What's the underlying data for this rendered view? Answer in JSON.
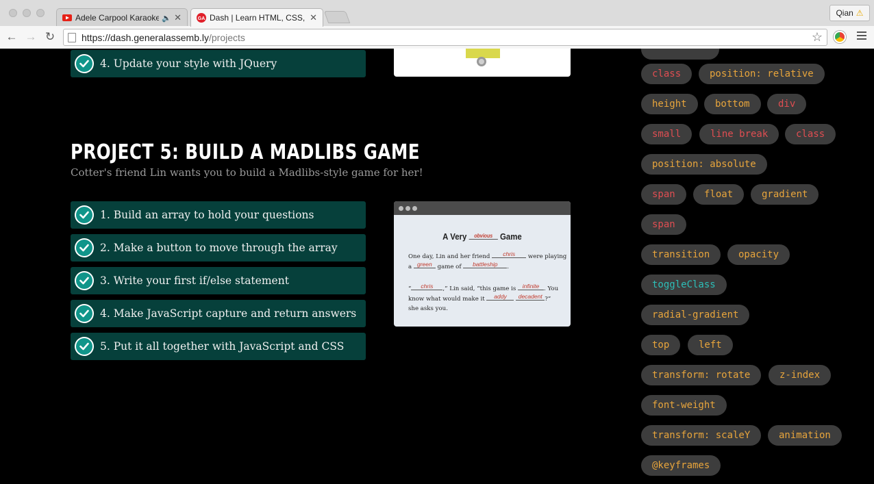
{
  "browser": {
    "tabs": [
      {
        "title": "Adele Carpool Karaoke -",
        "icon": "youtube-icon",
        "audio": true,
        "active": false
      },
      {
        "title": "Dash | Learn HTML, CSS, J",
        "icon": "general-assembly-icon",
        "active": true
      }
    ],
    "profile_name": "Qian",
    "url_host": "https://dash.generalassemb.ly",
    "url_path": "/projects"
  },
  "project4": {
    "last_task": "4. Update your style with JQuery"
  },
  "project5": {
    "title": "PROJECT 5: BUILD A MADLIBS GAME",
    "subtitle": "Cotter's friend Lin wants you to build a Madlibs-style game for her!",
    "tasks": [
      "1. Build an array to hold your questions",
      "2. Make a button to move through the array",
      "3. Write your first if/else statement",
      "4. Make JavaScript capture and return answers",
      "5. Put it all together with JavaScript and CSS"
    ],
    "preview": {
      "title_before": "A Very",
      "title_blank": "obvious",
      "title_after": "Game",
      "l1_a": "One day, Lin and her friend",
      "l1_blank": "chris",
      "l1_b": "were playing",
      "l2_a": "a",
      "l2_blank1": "green",
      "l2_b": "game of",
      "l2_blank2": "battleship",
      "l2_c": ".",
      "l3_a": "“",
      "l3_blank1": "chris",
      "l3_b": ",” Lin said, “this game is",
      "l3_blank2": "infinite",
      "l3_c": ". You",
      "l4_a": "know what would make it",
      "l4_blank1": "addy",
      "l4_blank2": "decadent",
      "l4_b": "?”",
      "l5": "she asks you."
    }
  },
  "tags": [
    {
      "label": "class",
      "color": "#e04e52"
    },
    {
      "label": "position: relative",
      "color": "#e8a53c"
    },
    {
      "label": "height",
      "color": "#e8a53c"
    },
    {
      "label": "bottom",
      "color": "#e8a53c"
    },
    {
      "label": "div",
      "color": "#e04e52"
    },
    {
      "label": "small",
      "color": "#e04e52"
    },
    {
      "label": "line break",
      "color": "#e04e52"
    },
    {
      "label": "class",
      "color": "#e04e52"
    },
    {
      "label": "position: absolute",
      "color": "#e8a53c"
    },
    {
      "label": "span",
      "color": "#e04e52"
    },
    {
      "label": "float",
      "color": "#e8a53c"
    },
    {
      "label": "gradient",
      "color": "#e8a53c"
    },
    {
      "label": "span",
      "color": "#e04e52"
    },
    {
      "label": "transition",
      "color": "#e8a53c"
    },
    {
      "label": "opacity",
      "color": "#e8a53c"
    },
    {
      "label": "toggleClass",
      "color": "#2dbfb8"
    },
    {
      "label": "radial-gradient",
      "color": "#e8a53c"
    },
    {
      "label": "top",
      "color": "#e8a53c"
    },
    {
      "label": "left",
      "color": "#e8a53c"
    },
    {
      "label": "transform: rotate",
      "color": "#e8a53c"
    },
    {
      "label": "z-index",
      "color": "#e8a53c"
    },
    {
      "label": "font-weight",
      "color": "#e8a53c"
    },
    {
      "label": "transform: scaleY",
      "color": "#e8a53c"
    },
    {
      "label": "animation",
      "color": "#e8a53c"
    },
    {
      "label": "@keyframes",
      "color": "#e8a53c"
    }
  ]
}
